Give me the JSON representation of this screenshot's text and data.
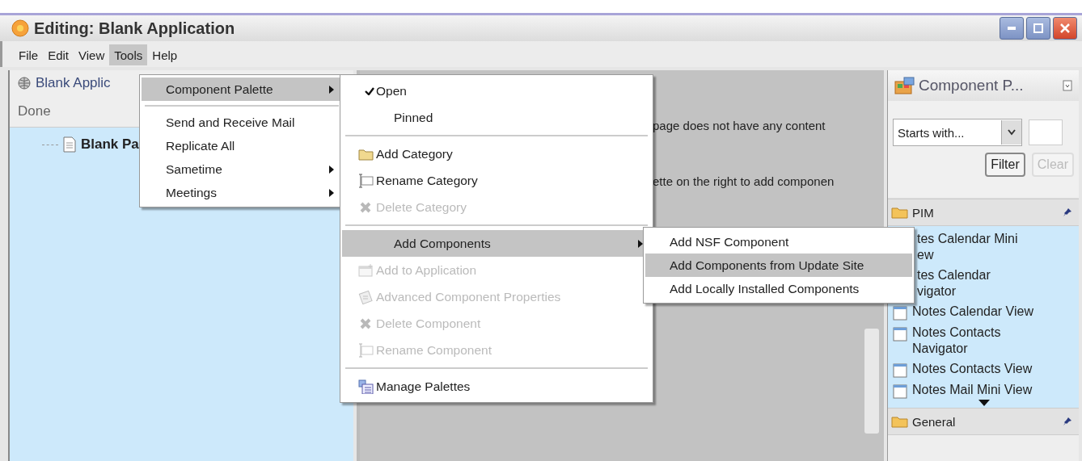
{
  "window": {
    "title": "Editing: Blank Application"
  },
  "menubar": [
    {
      "label": "File",
      "selected": false
    },
    {
      "label": "Edit",
      "selected": false
    },
    {
      "label": "View",
      "selected": false
    },
    {
      "label": "Tools",
      "selected": true
    },
    {
      "label": "Help",
      "selected": false
    }
  ],
  "left_panel": {
    "title": "Blank Applic",
    "status": "Done",
    "tree": [
      {
        "label": "Blank Pa"
      }
    ]
  },
  "center": {
    "lines": [
      "page does not have any content",
      "ette on the right to add componen"
    ]
  },
  "palette": {
    "title": "Component P...",
    "filter": {
      "mode": "Starts with..."
    },
    "buttons": [
      {
        "label": "Filter",
        "disabled": false
      },
      {
        "label": "Clear",
        "disabled": true
      }
    ],
    "categories": [
      {
        "name": "PIM",
        "expanded": true,
        "items": [
          {
            "label": "tes Calendar Mini\new",
            "covered": true
          },
          {
            "label": "tes Calendar\nvigator",
            "covered": true
          },
          {
            "label": "Notes Calendar View",
            "covered": false
          },
          {
            "label": "Notes Contacts\nNavigator",
            "covered": false
          },
          {
            "label": "Notes Contacts View",
            "covered": false
          },
          {
            "label": "Notes Mail Mini View",
            "covered": false
          }
        ]
      },
      {
        "name": "General",
        "expanded": false
      }
    ]
  },
  "menus": [
    {
      "items": [
        {
          "kind": "plain",
          "label": "Component Palette",
          "selected": true,
          "disabled": false,
          "submenu": true
        },
        {
          "kind": "separator"
        },
        {
          "kind": "plain",
          "label": "Send and Receive Mail",
          "selected": false,
          "disabled": false,
          "submenu": false
        },
        {
          "kind": "plain",
          "label": "Replicate All",
          "selected": false,
          "disabled": false,
          "submenu": false
        },
        {
          "kind": "plain",
          "label": "Sametime",
          "selected": false,
          "disabled": false,
          "submenu": true
        },
        {
          "kind": "plain",
          "label": "Meetings",
          "selected": false,
          "disabled": false,
          "submenu": true
        }
      ]
    },
    {
      "items": [
        {
          "kind": "check",
          "label": "Open",
          "checked": true,
          "selected": false,
          "disabled": false,
          "submenu": false
        },
        {
          "kind": "check",
          "label": "Pinned",
          "checked": false,
          "selected": false,
          "disabled": false,
          "submenu": false
        },
        {
          "kind": "separator"
        },
        {
          "kind": "folder",
          "label": "Add Category",
          "selected": false,
          "disabled": false,
          "submenu": false
        },
        {
          "kind": "rename",
          "label": "Rename Category",
          "selected": false,
          "disabled": false,
          "submenu": false
        },
        {
          "kind": "delete",
          "label": "Delete Category",
          "selected": false,
          "disabled": true,
          "submenu": false
        },
        {
          "kind": "separator"
        },
        {
          "kind": "plain",
          "label": "Add Components",
          "selected": true,
          "disabled": false,
          "submenu": true
        },
        {
          "kind": "add",
          "label": "Add to Application",
          "selected": false,
          "disabled": true,
          "submenu": false
        },
        {
          "kind": "properties",
          "label": "Advanced Component Properties",
          "selected": false,
          "disabled": true,
          "submenu": false
        },
        {
          "kind": "delete",
          "label": "Delete Component",
          "selected": false,
          "disabled": true,
          "submenu": false
        },
        {
          "kind": "rename",
          "label": "Rename Component",
          "selected": false,
          "disabled": true,
          "submenu": false
        },
        {
          "kind": "separator"
        },
        {
          "kind": "palettes",
          "label": "Manage Palettes",
          "selected": false,
          "disabled": false,
          "submenu": false
        }
      ]
    },
    {
      "items": [
        {
          "kind": "plain",
          "label": "Add NSF Component",
          "selected": false,
          "disabled": false,
          "submenu": false
        },
        {
          "kind": "plain",
          "label": "Add Components from Update Site",
          "selected": true,
          "disabled": false,
          "submenu": false
        },
        {
          "kind": "plain",
          "label": "Add Locally Installed Components",
          "selected": false,
          "disabled": false,
          "submenu": false
        }
      ]
    }
  ]
}
